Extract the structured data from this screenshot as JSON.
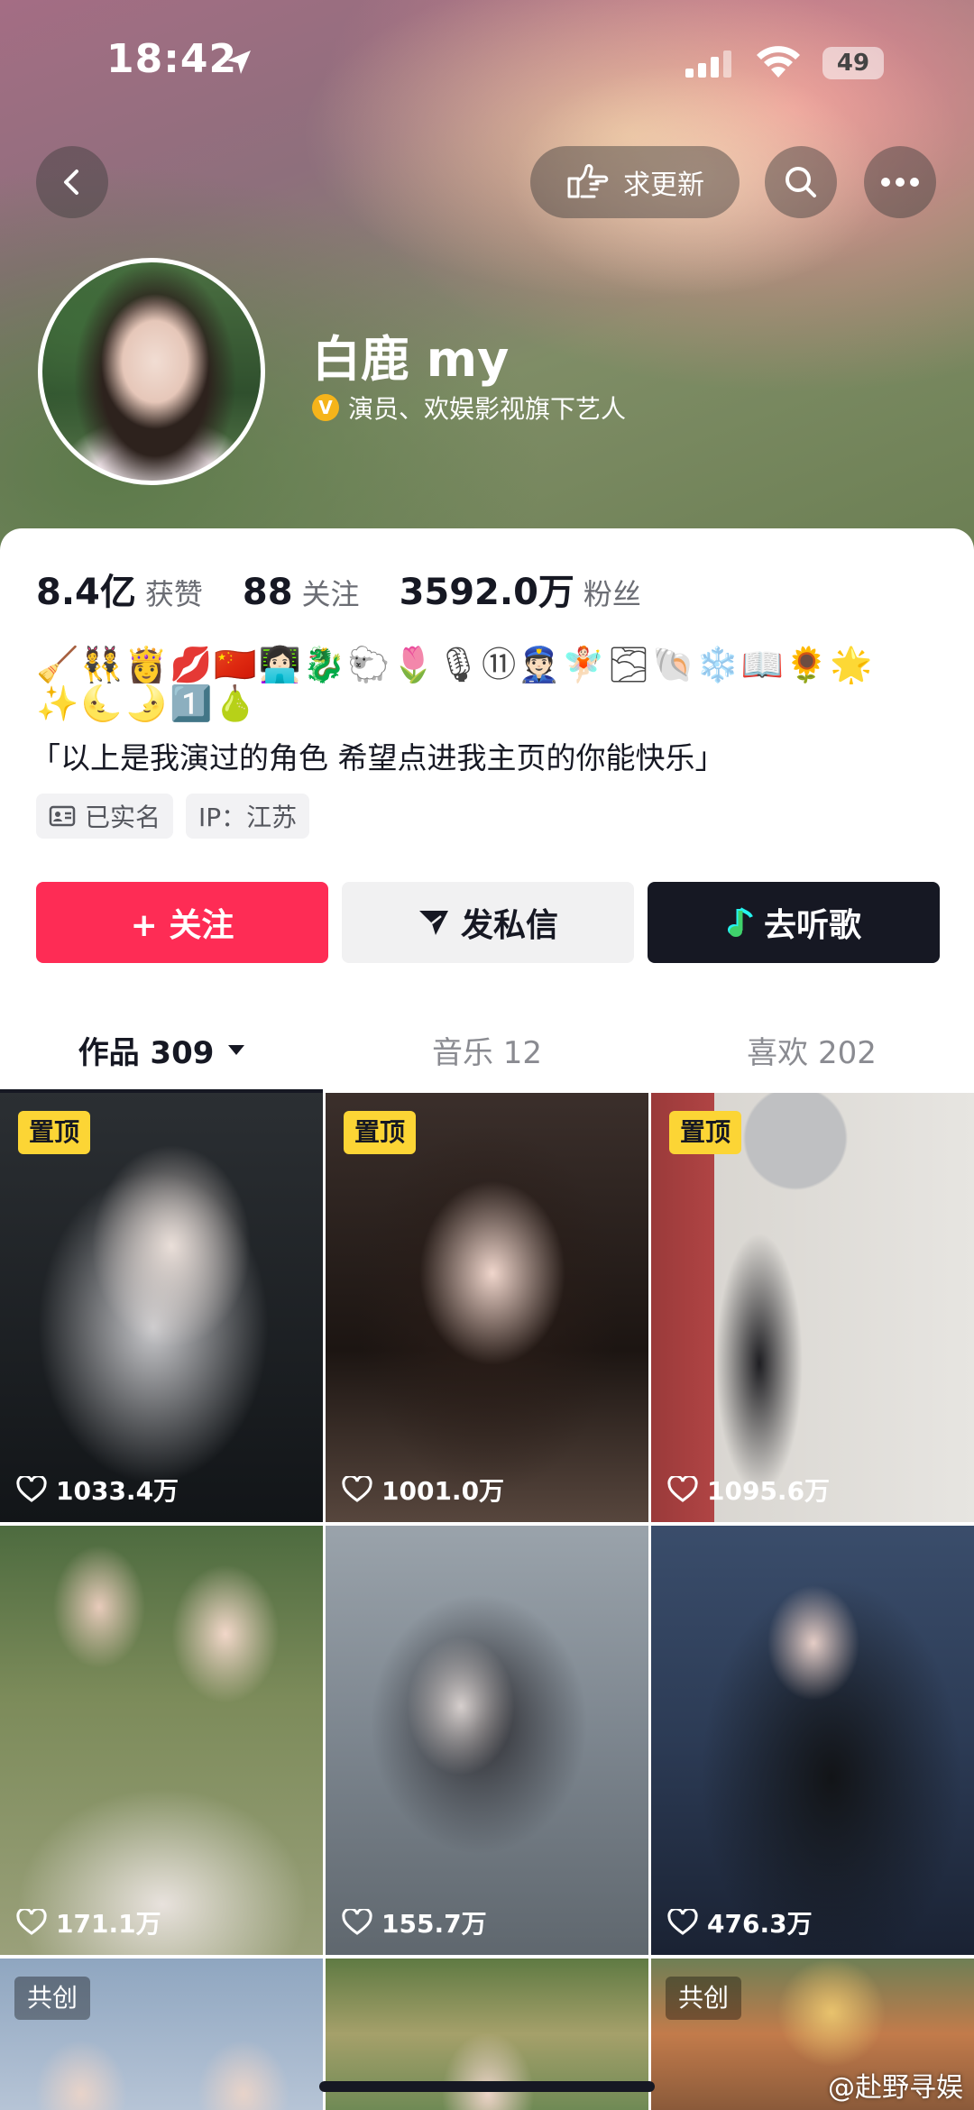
{
  "status_bar": {
    "time": "18:42",
    "battery": "49"
  },
  "header": {
    "request_update_label": "求更新"
  },
  "profile": {
    "name": "白鹿 my",
    "verification_badge": "V",
    "verified_title": "演员、欢娱影视旗下艺人",
    "stats": [
      {
        "value": "8.4亿",
        "label": "获赞"
      },
      {
        "value": "88",
        "label": "关注"
      },
      {
        "value": "3592.0万",
        "label": "粉丝"
      }
    ],
    "emoji_line_1": "🧹👯👸💋🇨🇳👩🏻‍💻🐉🐑🌷🎙⑪👮🏻🧚🏻🌫🐚❄️📖🌻🌟",
    "emoji_line_2": "✨🌜🌛1️⃣🍐",
    "bio": "「以上是我演过的角色 希望点进我主页的你能快乐」",
    "tags": [
      {
        "label": "已实名"
      },
      {
        "label": "IP：江苏"
      }
    ]
  },
  "actions": {
    "follow": "+ 关注",
    "message": "发私信",
    "music": "去听歌"
  },
  "tabs": [
    {
      "label": "作品 309",
      "active": true
    },
    {
      "label": "音乐 12",
      "active": false
    },
    {
      "label": "喜欢 202",
      "active": false
    }
  ],
  "videos": [
    {
      "badge": "置顶",
      "likes": "1033.4万"
    },
    {
      "badge": "置顶",
      "likes": "1001.0万"
    },
    {
      "badge": "置顶",
      "likes": "1095.6万"
    },
    {
      "badge": "",
      "likes": "171.1万"
    },
    {
      "badge": "",
      "likes": "155.7万"
    },
    {
      "badge": "",
      "likes": "476.3万"
    },
    {
      "badge": "共创",
      "likes": ""
    },
    {
      "badge": "",
      "likes": ""
    },
    {
      "badge": "共创",
      "likes": ""
    }
  ],
  "watermark": "@赴野寻娱"
}
